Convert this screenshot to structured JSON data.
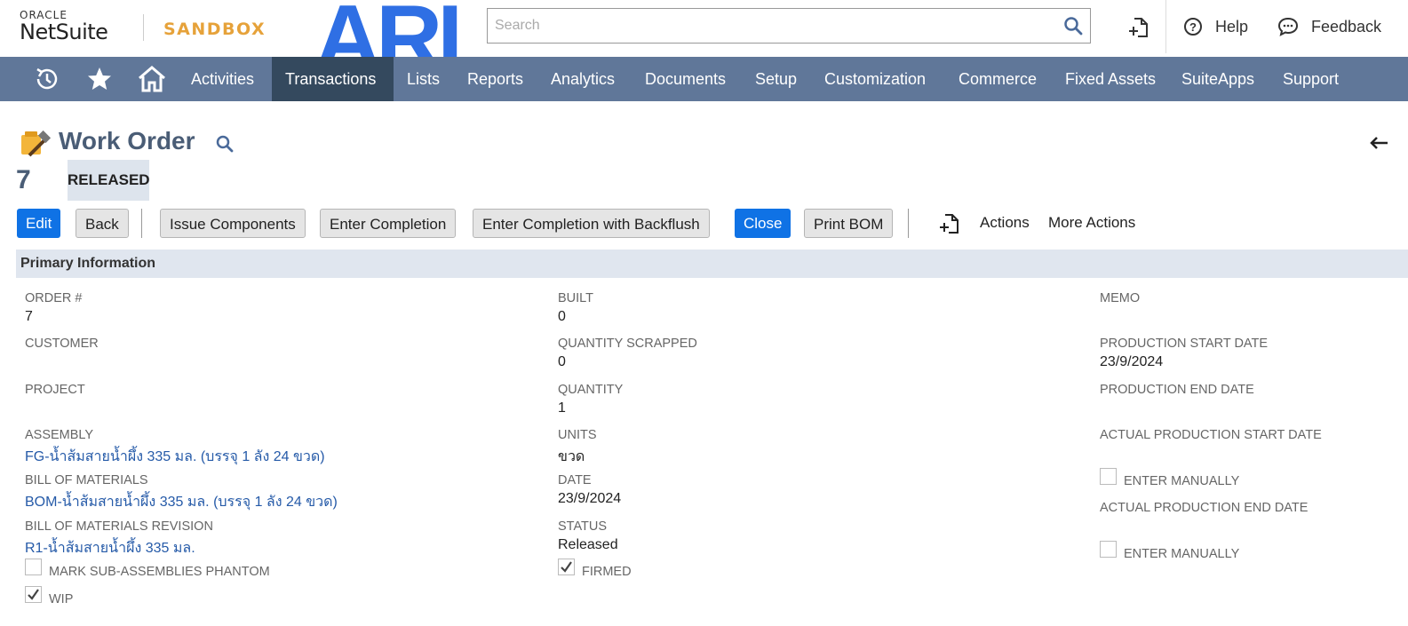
{
  "branding": {
    "oracle": "ORACLE",
    "netsuite": "NetSuite",
    "sandbox": "SANDBOX",
    "ari_logo": "ARI",
    "ari_color": "#2f6fe4"
  },
  "search": {
    "placeholder": "Search"
  },
  "header_links": {
    "help": "Help",
    "feedback": "Feedback"
  },
  "nav": {
    "icons": [
      "recent-records-icon",
      "star-icon",
      "home-icon"
    ],
    "items": [
      "Activities",
      "Transactions",
      "Lists",
      "Reports",
      "Analytics",
      "Documents",
      "Setup",
      "Customization",
      "Commerce",
      "Fixed Assets",
      "SuiteApps",
      "Support"
    ],
    "active": "Transactions",
    "bar_color": "#607799",
    "active_color": "#34495e"
  },
  "record": {
    "title": "Work Order",
    "number": "7",
    "status": "RELEASED"
  },
  "toolbar": {
    "edit": "Edit",
    "back": "Back",
    "issue_components": "Issue Components",
    "enter_completion": "Enter Completion",
    "enter_completion_backflush": "Enter Completion with Backflush",
    "close": "Close",
    "print_bom": "Print BOM",
    "actions": "Actions",
    "more_actions": "More Actions",
    "primary_color": "#0f72e5"
  },
  "section": {
    "title": "Primary Information"
  },
  "fields": {
    "order_label": "ORDER #",
    "order_value": "7",
    "customer_label": "CUSTOMER",
    "project_label": "PROJECT",
    "assembly_label": "ASSEMBLY",
    "assembly_value": "FG-น้ำส้มสายน้ำผึ้ง 335 มล. (บรรจุ 1 ลัง 24 ขวด)",
    "bom_label": "BILL OF MATERIALS",
    "bom_value": "BOM-น้ำส้มสายน้ำผึ้ง 335 มล. (บรรจุ 1 ลัง 24 ขวด)",
    "bom_rev_label": "BILL OF MATERIALS REVISION",
    "bom_rev_value": "R1-น้ำส้มสายน้ำผึ้ง 335 มล.",
    "phantom_label": "MARK SUB-ASSEMBLIES PHANTOM",
    "phantom_checked": false,
    "wip_label": "WIP",
    "wip_checked": true,
    "built_label": "BUILT",
    "built_value": "0",
    "scrapped_label": "QUANTITY SCRAPPED",
    "scrapped_value": "0",
    "quantity_label": "QUANTITY",
    "quantity_value": "1",
    "units_label": "UNITS",
    "units_value": "ขวด",
    "date_label": "DATE",
    "date_value": "23/9/2024",
    "status_label": "STATUS",
    "status_value": "Released",
    "firmed_label": "FIRMED",
    "firmed_checked": true,
    "memo_label": "MEMO",
    "prod_start_label": "PRODUCTION START DATE",
    "prod_start_value": "23/9/2024",
    "prod_end_label": "PRODUCTION END DATE",
    "actual_start_label": "ACTUAL PRODUCTION START DATE",
    "enter_manually_1": "ENTER MANUALLY",
    "enter_manually_1_checked": false,
    "actual_end_label": "ACTUAL PRODUCTION END DATE",
    "enter_manually_2": "ENTER MANUALLY",
    "enter_manually_2_checked": false
  }
}
